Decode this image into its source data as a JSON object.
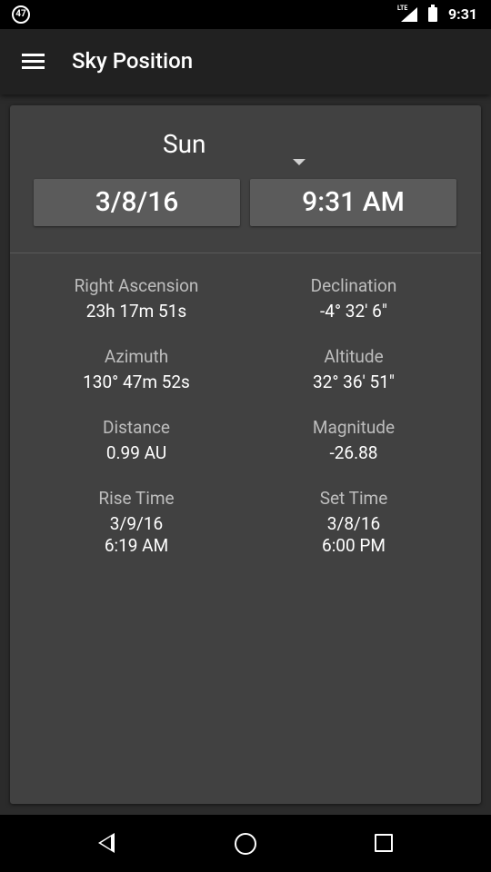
{
  "status_bar": {
    "notification_badge": "47",
    "network": "LTE",
    "clock": "9:31"
  },
  "app_bar": {
    "title": "Sky Position",
    "menu_icon": "hamburger-menu-icon"
  },
  "selector": {
    "body": "Sun",
    "date": "3/8/16",
    "time": "9:31 AM"
  },
  "info": [
    {
      "label": "Right Ascension",
      "value": "23h 17m 51s"
    },
    {
      "label": "Declination",
      "value": "-4° 32' 6\""
    },
    {
      "label": "Azimuth",
      "value": "130° 47m 52s"
    },
    {
      "label": "Altitude",
      "value": "32° 36' 51\""
    },
    {
      "label": "Distance",
      "value": "0.99 AU"
    },
    {
      "label": "Magnitude",
      "value": "-26.88"
    },
    {
      "label": "Rise Time",
      "value": "3/9/16",
      "value2": "6:19 AM"
    },
    {
      "label": "Set Time",
      "value": "3/8/16",
      "value2": "6:00 PM"
    }
  ],
  "nav_bar": {
    "back_icon": "back-triangle-icon",
    "home_icon": "home-circle-icon",
    "recents_icon": "recents-square-icon"
  },
  "colors": {
    "background": "#2b2b2b",
    "app_bar": "#212121",
    "card": "#414141",
    "button": "#5b5b5b",
    "label_text": "#bdbdbd"
  }
}
